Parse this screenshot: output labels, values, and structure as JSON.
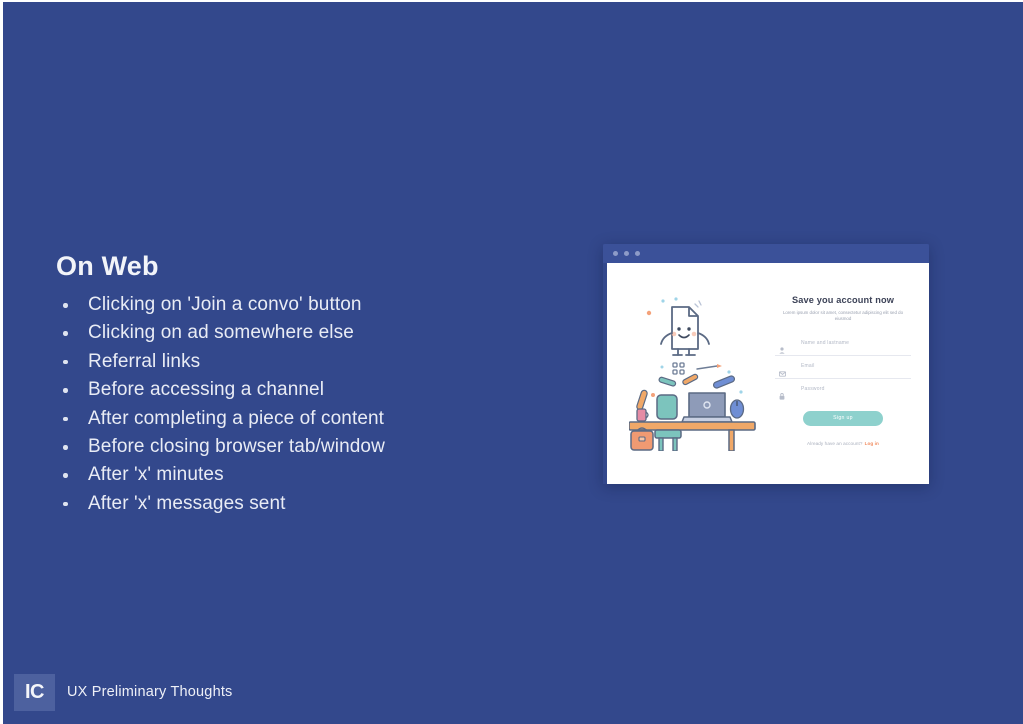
{
  "slide": {
    "background_color": "#33488c",
    "title": "On Web",
    "bullets": [
      "Clicking on 'Join a convo' button",
      "Clicking on ad somewhere else",
      "Referral links",
      "Before accessing a channel",
      "After completing a piece of content",
      "Before closing browser tab/window",
      "After 'x' minutes",
      "After 'x' messages sent"
    ]
  },
  "browser_mockup": {
    "titlebar": {
      "color": "#3b5199",
      "dot_color": "#8d9bc8",
      "dots": [
        "close-dot",
        "minimize-dot",
        "maximize-dot"
      ]
    },
    "signup": {
      "title": "Save you account now",
      "subtitle": "Lorem ipsum dolor sit amet, consectetur adipiscing elit sed do eiusmod",
      "fields": [
        {
          "icon": "user-icon",
          "label": "Name and lastname",
          "placeholder": "Name and lastname"
        },
        {
          "icon": "mail-icon",
          "label": "Email",
          "placeholder": "Email"
        },
        {
          "icon": "lock-icon",
          "label": "Password",
          "placeholder": "Password"
        }
      ],
      "submit_label": "Sign up",
      "submit_color": "#8ed1cd",
      "footer_text": "Already have an account?",
      "footer_link": "Log in",
      "footer_link_color": "#f08a5d"
    },
    "illustration": {
      "name": "desk-workspace-illustration",
      "desk_color": "#f0a868",
      "chair_color": "#7cc4bd",
      "laptop_color": "#8e9bb8",
      "bag_color": "#f09a72",
      "document_character": "smiling-document-character"
    }
  },
  "footer": {
    "logo_text": "IC",
    "logo_color": "#4d619f",
    "label": "UX Preliminary Thoughts"
  }
}
